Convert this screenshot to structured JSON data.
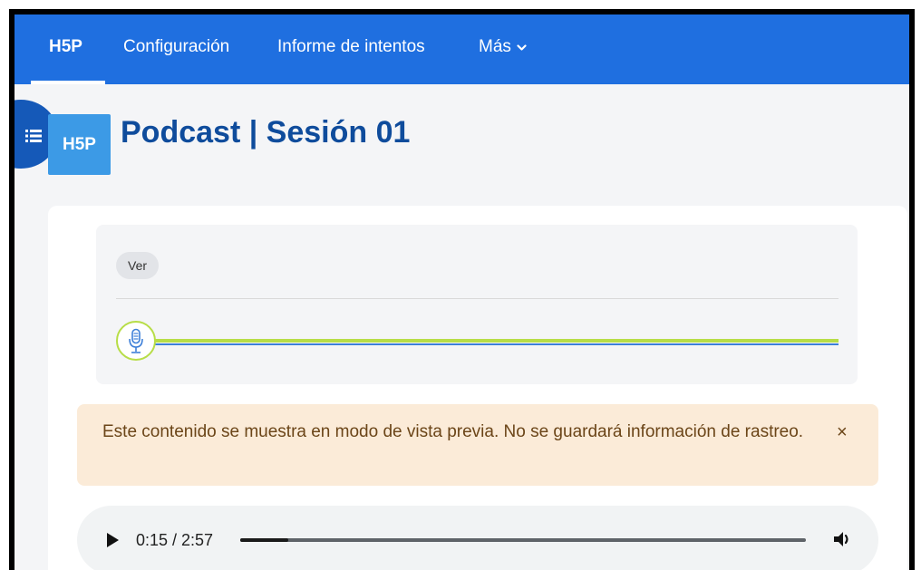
{
  "nav": {
    "items": [
      {
        "label": "H5P",
        "active": true
      },
      {
        "label": "Configuración",
        "active": false
      },
      {
        "label": "Informe de intentos",
        "active": false
      },
      {
        "label": "Más",
        "active": false
      }
    ],
    "more_icon": "chevron-down-icon",
    "bg_color": "#1f6fe0"
  },
  "drawer": {
    "icon": "list-icon"
  },
  "activity": {
    "logo_text": "H5P",
    "title": "Podcast | Sesión 01",
    "title_color": "#0f4c9c"
  },
  "h5p_panel": {
    "ver_label": "Ver",
    "mic_icon": "microphone-icon",
    "track_colors": {
      "green": "#b7dd47",
      "blue": "#3d7fd8"
    }
  },
  "alert": {
    "text": "Este contenido se muestra en modo de vista previa. No se guardará información de rastreo.",
    "close_label": "×",
    "bg_color": "#fbebd8"
  },
  "audio": {
    "time": "0:15 / 2:57",
    "progress": 0.0847,
    "play_icon": "play-icon",
    "volume_icon": "volume-icon"
  }
}
